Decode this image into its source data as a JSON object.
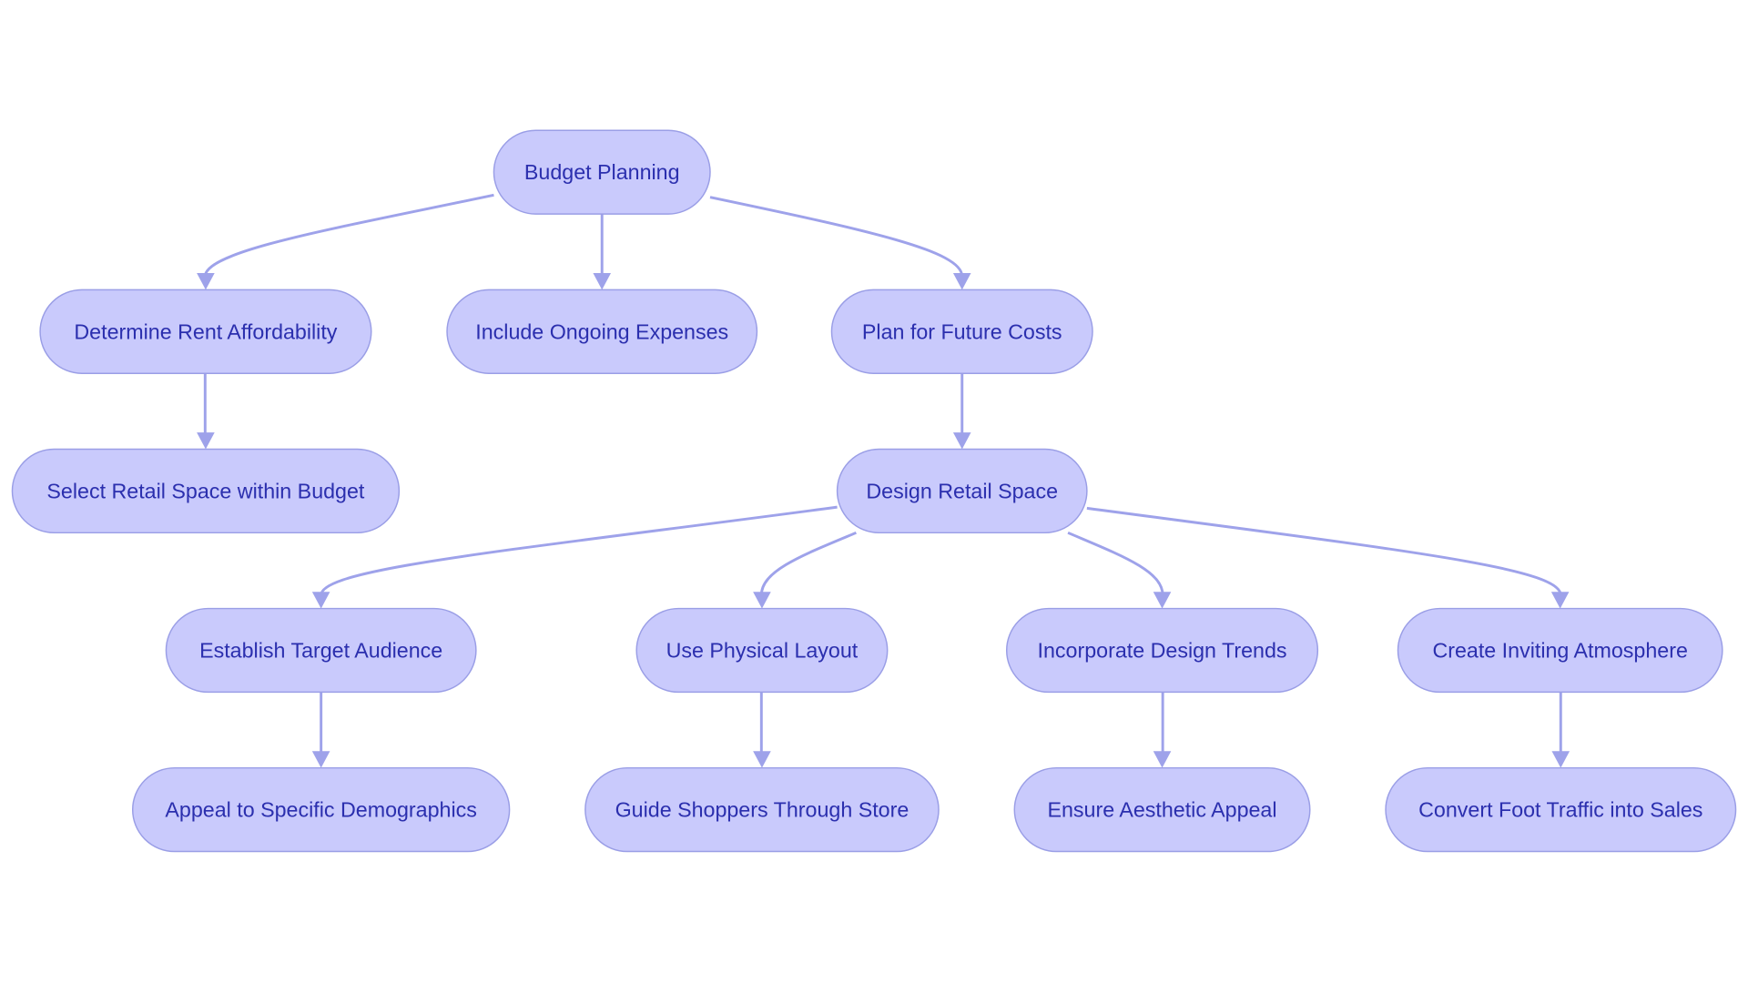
{
  "diagram": {
    "type": "flowchart",
    "colors": {
      "node_fill": "#c9cafc",
      "node_stroke": "#9a9ee6",
      "text": "#2b2fae",
      "edge": "#9ea2ea"
    },
    "nodes": [
      {
        "id": "budget",
        "label": "Budget Planning"
      },
      {
        "id": "rent",
        "label": "Determine Rent Affordability"
      },
      {
        "id": "ongoing",
        "label": "Include Ongoing Expenses"
      },
      {
        "id": "future",
        "label": "Plan for Future Costs"
      },
      {
        "id": "select",
        "label": "Select Retail Space within Budget"
      },
      {
        "id": "design",
        "label": "Design Retail Space"
      },
      {
        "id": "audience",
        "label": "Establish Target Audience"
      },
      {
        "id": "layout",
        "label": "Use Physical Layout"
      },
      {
        "id": "trends",
        "label": "Incorporate Design Trends"
      },
      {
        "id": "atmosphere",
        "label": "Create Inviting Atmosphere"
      },
      {
        "id": "demographics",
        "label": "Appeal to Specific Demographics"
      },
      {
        "id": "guide",
        "label": "Guide Shoppers Through Store"
      },
      {
        "id": "aesthetic",
        "label": "Ensure Aesthetic Appeal"
      },
      {
        "id": "convert",
        "label": "Convert Foot Traffic into Sales"
      }
    ],
    "edges": [
      {
        "from": "budget",
        "to": "rent"
      },
      {
        "from": "budget",
        "to": "ongoing"
      },
      {
        "from": "budget",
        "to": "future"
      },
      {
        "from": "rent",
        "to": "select"
      },
      {
        "from": "future",
        "to": "design"
      },
      {
        "from": "design",
        "to": "audience"
      },
      {
        "from": "design",
        "to": "layout"
      },
      {
        "from": "design",
        "to": "trends"
      },
      {
        "from": "design",
        "to": "atmosphere"
      },
      {
        "from": "audience",
        "to": "demographics"
      },
      {
        "from": "layout",
        "to": "guide"
      },
      {
        "from": "trends",
        "to": "aesthetic"
      },
      {
        "from": "atmosphere",
        "to": "convert"
      }
    ]
  }
}
